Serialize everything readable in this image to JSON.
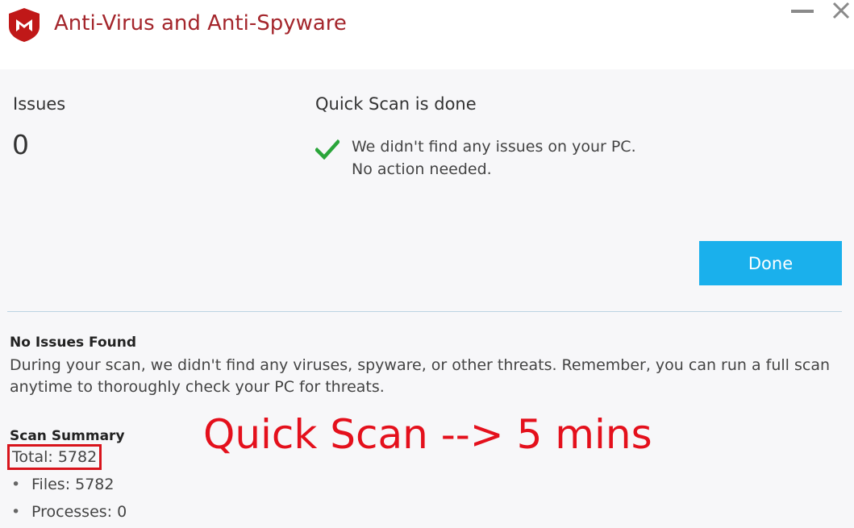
{
  "window": {
    "title": "Anti-Virus and Anti-Spyware",
    "brand_color": "#a4262c"
  },
  "issues": {
    "label": "Issues",
    "count": "0"
  },
  "scan": {
    "title": "Quick Scan is done",
    "message_line1": "We didn't find any issues on your PC.",
    "message_line2": "No action needed.",
    "done_label": "Done",
    "accent_color": "#1ab0ec"
  },
  "summary": {
    "heading": "No Issues Found",
    "text": "During your scan, we didn't find any viruses, spyware, or other threats. Remember, you can run a full scan anytime to thoroughly check your PC for threats.",
    "scan_summary_label": "Scan Summary",
    "total": "Total: 5782",
    "items": [
      "Files: 5782",
      "Processes: 0"
    ]
  },
  "annotation": {
    "text": "Quick Scan --> 5 mins",
    "color": "#e4101c"
  }
}
